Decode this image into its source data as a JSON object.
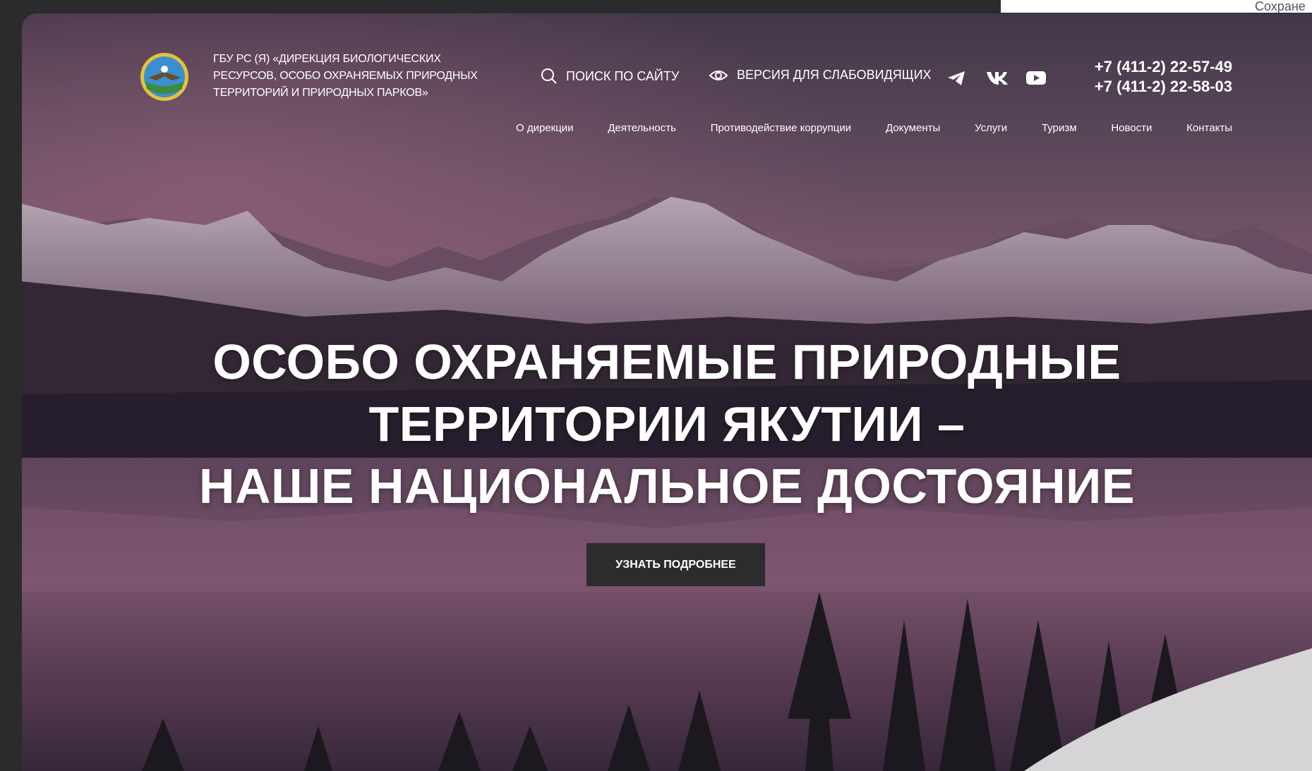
{
  "browser": {
    "top_right_text": "Сохране"
  },
  "header": {
    "org_lines": [
      "ГБУ РС (Я) «Дирекция биологических",
      "ресурсов, особо охраняемых природных",
      "территорий и природных парков»"
    ],
    "search_label": "поиск по сайту",
    "vision_label": "версия для слабовидящих",
    "phones": [
      "+7 (411-2) 22-57-49",
      "+7 (411-2) 22-58-03"
    ],
    "socials": [
      "telegram-icon",
      "vk-icon",
      "youtube-icon"
    ]
  },
  "nav": {
    "items": [
      "О дирекции",
      "Деятельность",
      "Противодействие коррупции",
      "Документы",
      "Услуги",
      "Туризм",
      "Новости",
      "Контакты"
    ]
  },
  "hero": {
    "headline_lines": [
      "ОСОБО ОХРАНЯЕМЫЕ ПРИРОДНЫЕ",
      "ТЕРРИТОРИИ ЯКУТИИ –",
      "НАШЕ НАЦИОНАЛЬНОЕ ДОСТОЯНИЕ"
    ],
    "cta_label": "УЗНАТЬ ПОДРОБНЕЕ"
  },
  "colors": {
    "page_bg": "#2b2b2d",
    "button_bg": "#2c2c2e",
    "sky": "#5c4a63",
    "mountain_snow": "#cbbccb",
    "lake": "#6a4a64"
  }
}
